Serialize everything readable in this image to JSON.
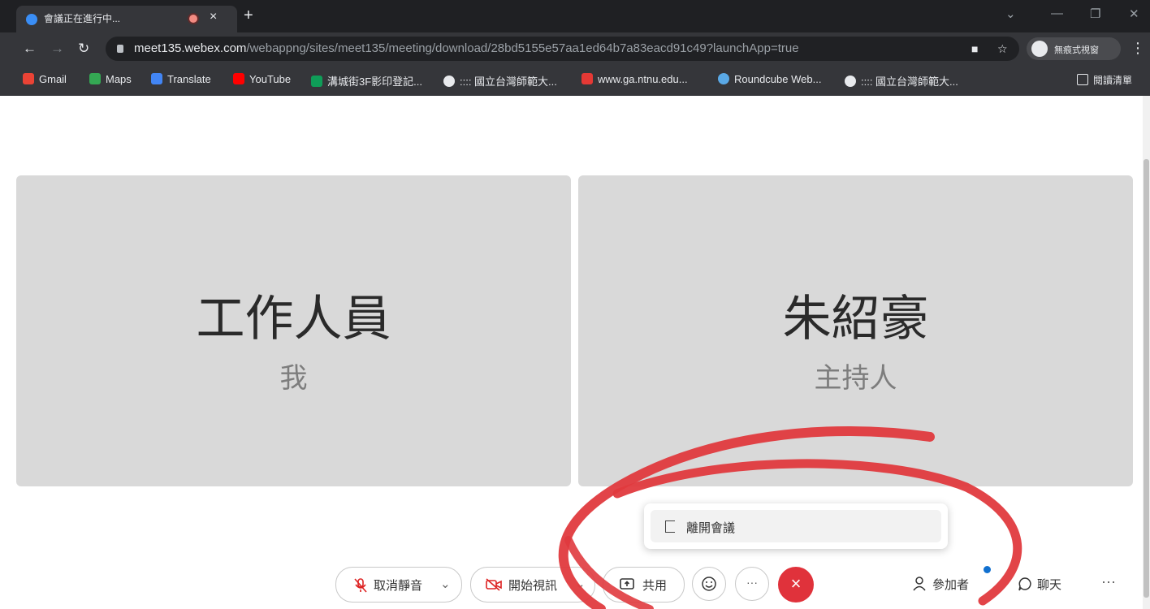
{
  "browser": {
    "tab_title": "會議正在進行中...",
    "tab_close": "×",
    "new_tab": "+",
    "url_domain": "meet135.webex.com",
    "url_path": "/webappng/sites/meet135/meeting/download/28bd5155e57aa1ed64b7a83eacd91c49?launchApp=true",
    "incognito_label": "無痕式視窗",
    "bookmarks": [
      {
        "label": "Gmail",
        "color": "#ea4335"
      },
      {
        "label": "Maps",
        "color": "#34a853"
      },
      {
        "label": "Translate",
        "color": "#4285f4"
      },
      {
        "label": "YouTube",
        "color": "#ff0000"
      },
      {
        "label": "溝城街3F影印登記...",
        "color": "#0f9d58"
      },
      {
        "label": ":::: 國立台灣師範大...",
        "color": "#e8eaed"
      },
      {
        "label": "www.ga.ntnu.edu...",
        "color": "#e53935"
      },
      {
        "label": "Roundcube Web...",
        "color": "#5aa9e6"
      },
      {
        "label": ":::: 國立台灣師範大...",
        "color": "#e8eaed"
      }
    ],
    "reading_list": "閱讀清單"
  },
  "participants": [
    {
      "name": "工作人員",
      "role": "我"
    },
    {
      "name": "朱紹豪",
      "role": "主持人"
    }
  ],
  "leave_menu": {
    "label": "離開會議"
  },
  "controls": {
    "mute": "取消靜音",
    "video": "開始視訊",
    "share": "共用",
    "participants": "參加者",
    "chat": "聊天",
    "more": "···",
    "end": "×"
  },
  "colors": {
    "end_button": "#e0323b",
    "annotation": "#e03a3e",
    "notify_dot": "#1170cf"
  }
}
